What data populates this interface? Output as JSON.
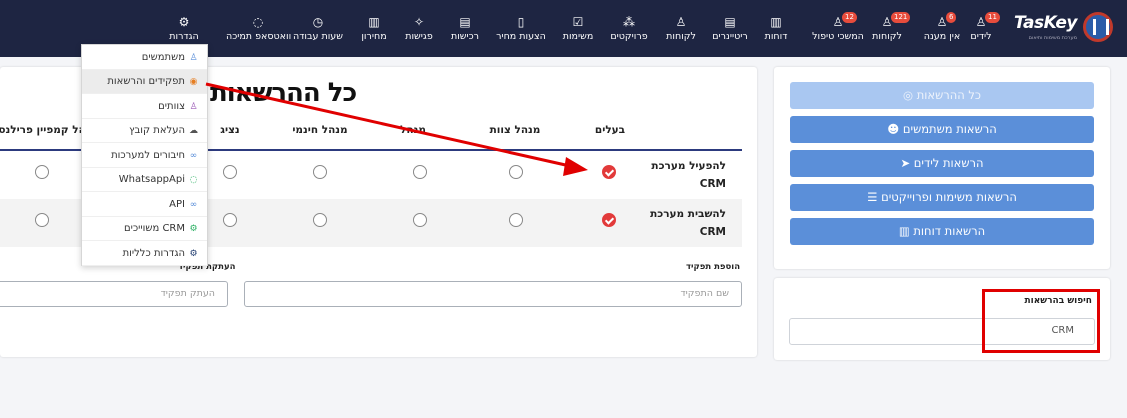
{
  "brand": {
    "name": "TasKey",
    "tagline": "מערכת משימות ותיאום"
  },
  "nav": [
    {
      "label": "לידים",
      "icon": "user-icon",
      "glyph": "♙",
      "badge": "11"
    },
    {
      "label": "אין מענה",
      "icon": "user-icon",
      "glyph": "♙",
      "badge": "6"
    },
    {
      "label": "לקוחות",
      "icon": "user-icon",
      "glyph": "♙",
      "badge": "121"
    },
    {
      "label": "המשכי טיפול",
      "icon": "user-icon",
      "glyph": "♙",
      "badge": "12"
    },
    {
      "label": "דוחות",
      "icon": "bar-chart-icon",
      "glyph": "▥",
      "badge": ""
    },
    {
      "label": "ריטיינרים",
      "icon": "document-icon",
      "glyph": "▤",
      "badge": ""
    },
    {
      "label": "לקוחות",
      "icon": "user-icon",
      "glyph": "♙",
      "badge": ""
    },
    {
      "label": "פרויקטים",
      "icon": "cubes-icon",
      "glyph": "⁂",
      "badge": ""
    },
    {
      "label": "משימות",
      "icon": "check-square-icon",
      "glyph": "☑",
      "badge": ""
    },
    {
      "label": "הצעות מחיר",
      "icon": "file-icon",
      "glyph": "▯",
      "badge": ""
    },
    {
      "label": "רכישות",
      "icon": "invoice-icon",
      "glyph": "▤",
      "badge": ""
    },
    {
      "label": "פגישות",
      "icon": "handshake-icon",
      "glyph": "✧",
      "badge": ""
    },
    {
      "label": "מחירון",
      "icon": "barcode-icon",
      "glyph": "▥",
      "badge": ""
    },
    {
      "label": "שעות עבודה",
      "icon": "clock-icon",
      "glyph": "◷",
      "badge": ""
    },
    {
      "label": "וואטסאפ תמיכה",
      "icon": "whatsapp-icon",
      "glyph": "◌",
      "badge": ""
    },
    {
      "label": "הגדרות",
      "icon": "gear-icon",
      "glyph": "⚙",
      "badge": ""
    }
  ],
  "sidebar": {
    "buttons": [
      {
        "label": "כל ההרשאות",
        "icon": "eye-slash-icon",
        "glyph": "◎",
        "active": true
      },
      {
        "label": "הרשאות משתמשים",
        "icon": "users-icon",
        "glyph": "☻",
        "active": false
      },
      {
        "label": "הרשאות לידים",
        "icon": "paper-plane-icon",
        "glyph": "➤",
        "active": false
      },
      {
        "label": "הרשאות משימות ופרוייקטים",
        "icon": "list-icon",
        "glyph": "☰",
        "active": false
      },
      {
        "label": "הרשאות דוחות",
        "icon": "bar-chart-icon",
        "glyph": "▥",
        "active": false
      }
    ],
    "search": {
      "label": "חיפוש בהרשאות",
      "value": "CRM"
    }
  },
  "main": {
    "title": "כל ההרשאות",
    "columns": [
      "בעלים",
      "מנהל צוות",
      "מנהל",
      "מנהל חינמי",
      "נציג",
      "מנהל קמפיין פרילנסר"
    ],
    "rows": [
      {
        "label_line1": "להפעיל מערכת",
        "label_line2": "CRM",
        "selected": 0
      },
      {
        "label_line1": "להשבית מערכת",
        "label_line2": "CRM",
        "selected": 0
      }
    ],
    "add_role": {
      "label": "הוספת תפקיד",
      "placeholder": "שם התפקיד"
    },
    "copy_role": {
      "label": "העתקת תפקיד",
      "placeholder": "העתק תפקיד"
    }
  },
  "dropdown": [
    {
      "label": "משתמשים",
      "icon": "users-icon",
      "glyph": "♙",
      "color": "#5b8fd9",
      "highlighted": false
    },
    {
      "label": "תפקידים והרשאות",
      "icon": "eye-icon",
      "glyph": "◉",
      "color": "#e67e22",
      "highlighted": true
    },
    {
      "label": "צוותים",
      "icon": "users-group-icon",
      "glyph": "♙",
      "color": "#9b59b6",
      "highlighted": false
    },
    {
      "label": "העלאת קובץ",
      "icon": "cloud-upload-icon",
      "glyph": "☁",
      "color": "#555555",
      "highlighted": false
    },
    {
      "label": "חיבורים למערכות",
      "icon": "link-icon",
      "glyph": "∞",
      "color": "#5b8fd9",
      "highlighted": false
    },
    {
      "label": "WhatsappApi",
      "icon": "whatsapp-icon",
      "glyph": "◌",
      "color": "#27ae60",
      "highlighted": false
    },
    {
      "label": "API",
      "icon": "link-icon",
      "glyph": "∞",
      "color": "#5b8fd9",
      "highlighted": false
    },
    {
      "label": "CRM משוייכים",
      "icon": "gear-icon",
      "glyph": "⚙",
      "color": "#27ae60",
      "highlighted": false
    },
    {
      "label": "הגדרות כלליות",
      "icon": "gear-icon",
      "glyph": "⚙",
      "color": "#1e3a6e",
      "highlighted": false
    }
  ],
  "colors": {
    "nav_bg": "#1e2542",
    "primary": "#5b8fd9",
    "primary_light": "#a9c7f1",
    "accent_red": "#e23a3a",
    "annotation": "#e00000"
  }
}
